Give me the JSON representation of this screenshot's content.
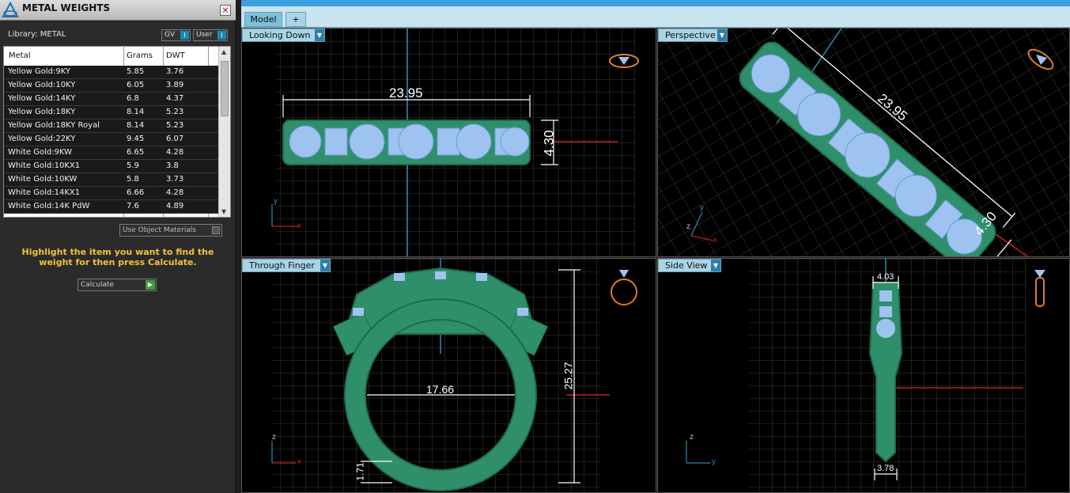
{
  "panel": {
    "title": "METAL WEIGHTS",
    "close": "×",
    "library_label": "Library: METAL",
    "gv_label": "GV",
    "user_label": "User",
    "toggle_indicator": "I",
    "use_object_materials": "Use Object Materials",
    "hint": "Highlight the item you want to find the weight for then press Calculate.",
    "calculate_label": "Calculate",
    "calculate_icon": "play-icon"
  },
  "table": {
    "headers": [
      "Metal",
      "Grams",
      "DWT"
    ],
    "rows": [
      [
        "Yellow Gold:9KY",
        "5.85",
        "3.76"
      ],
      [
        "Yellow Gold:10KY",
        "6.05",
        "3.89"
      ],
      [
        "Yellow Gold:14KY",
        "6.8",
        "4.37"
      ],
      [
        "Yellow Gold:18KY",
        "8.14",
        "5.23"
      ],
      [
        "Yellow Gold:18KY Royal",
        "8.14",
        "5.23"
      ],
      [
        "Yellow Gold:22KY",
        "9.45",
        "6.07"
      ],
      [
        "White Gold:9KW",
        "6.65",
        "4.28"
      ],
      [
        "White Gold:10KX1",
        "5.9",
        "3.8"
      ],
      [
        "White Gold:10KW",
        "5.8",
        "3.73"
      ],
      [
        "White Gold:14KX1",
        "6.66",
        "4.28"
      ],
      [
        "White Gold:14K PdW",
        "7.6",
        "4.89"
      ]
    ]
  },
  "tabs": {
    "model": "Model",
    "add": "+"
  },
  "viewports": {
    "looking_down": {
      "label": "Looking Down",
      "dim_length": "23.95",
      "dim_width": "4.30",
      "axis_y": "y",
      "axis_x": "x"
    },
    "perspective": {
      "label": "Perspective",
      "dim_length": "23.95",
      "dim_width": "4.30",
      "axis_y": "y",
      "axis_x": "x",
      "axis_z": "z"
    },
    "through_finger": {
      "label": "Through Finger",
      "dim_inner": "17.66",
      "dim_height": "25.27",
      "dim_shank": "1.71",
      "axis_z": "z",
      "axis_x": "x"
    },
    "side_view": {
      "label": "Side View",
      "dim_top": "4.03",
      "dim_bottom": "3.78",
      "axis_z": "z",
      "axis_y": "y"
    }
  },
  "colors": {
    "ring_green": "#2f8f6a",
    "stone_blue": "#9ec3f0",
    "accent_cyan": "#1a8ab0",
    "hint_yellow": "#f2c23a"
  }
}
